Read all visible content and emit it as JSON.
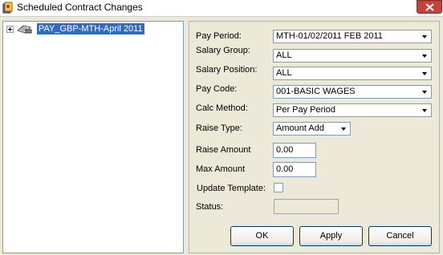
{
  "window": {
    "title": "Scheduled Contract Changes"
  },
  "tree": {
    "items": [
      {
        "label": "PAY_GBP-MTH-April 2011",
        "icon": "payroll-folder-icon",
        "selected": true
      }
    ]
  },
  "form": {
    "pay_period": {
      "label": "Pay Period:",
      "value": "MTH-01/02/2011  FEB 2011"
    },
    "salary_group": {
      "label": "Salary Group:",
      "value": "ALL"
    },
    "salary_position": {
      "label": "Salary Position:",
      "value": "ALL"
    },
    "pay_code": {
      "label": "Pay Code:",
      "value": "001-BASIC WAGES"
    },
    "calc_method": {
      "label": "Calc Method:",
      "value": "Per Pay Period"
    },
    "raise_type": {
      "label": "Raise Type:",
      "value": "Amount Add"
    },
    "raise_amount": {
      "label": "Raise Amount",
      "value": "0.00"
    },
    "max_amount": {
      "label": "Max Amount",
      "value": "0.00"
    },
    "update_template": {
      "label": "Update Template:",
      "checked": false
    },
    "status": {
      "label": "Status:",
      "value": ""
    }
  },
  "buttons": {
    "ok": "OK",
    "apply": "Apply",
    "cancel": "Cancel"
  },
  "colors": {
    "selection": "#316ac5",
    "close_button": "#c7423a",
    "background": "#ece9d8"
  }
}
